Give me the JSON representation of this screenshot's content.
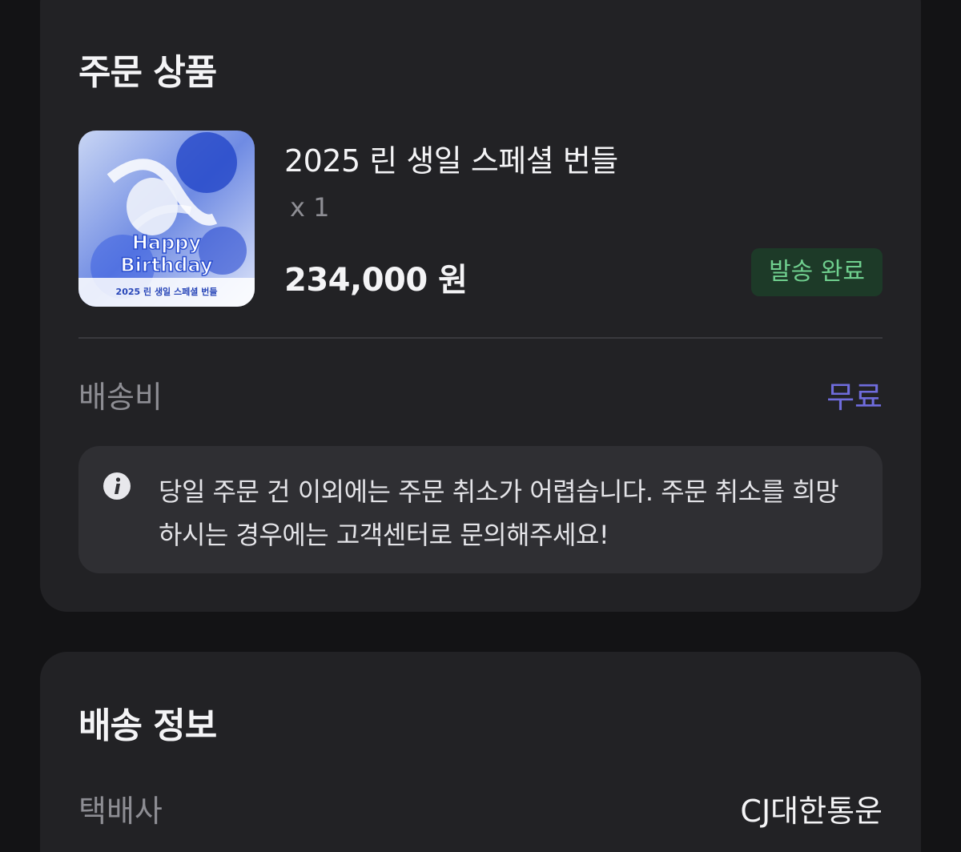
{
  "order_section": {
    "title": "주문 상품",
    "product": {
      "name": "2025 린 생일 스페셜 번들",
      "quantity": "x 1",
      "price": "234,000 원",
      "status": "발송 완료",
      "thumbnail_text": {
        "line1": "Happy",
        "line2": "Birthday",
        "caption": "2025 린 생일 스페셜 번들"
      }
    },
    "shipping_fee": {
      "label": "배송비",
      "value": "무료"
    },
    "notice": {
      "icon": "info-icon",
      "text": "당일 주문 건 이외에는 주문 취소가 어렵습니다. 주문 취소를 희망하시는 경우에는 고객센터로 문의해주세요!"
    }
  },
  "shipping_section": {
    "title": "배송 정보",
    "courier": {
      "label": "택배사",
      "value": "CJ대한통운"
    }
  },
  "colors": {
    "background": "#131315",
    "card": "#222225",
    "notice_bg": "#2f2f33",
    "accent": "#6f6cdc",
    "status_bg": "#1d3a28",
    "status_text": "#6fcf8e",
    "muted_text": "#8e8e94"
  }
}
